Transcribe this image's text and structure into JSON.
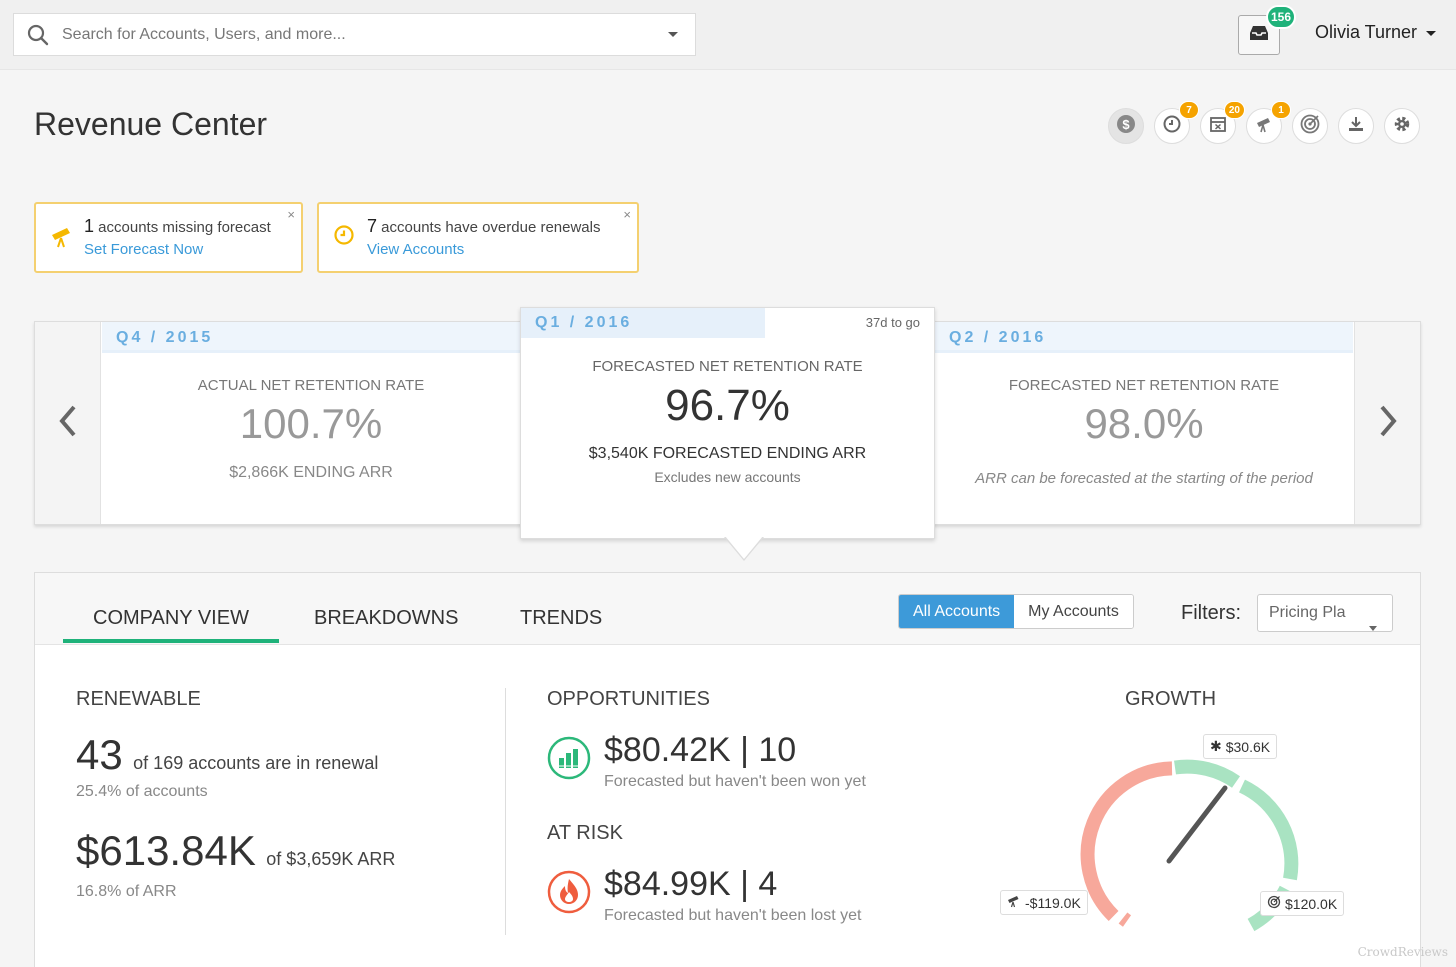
{
  "search": {
    "placeholder": "Search for Accounts, Users, and more..."
  },
  "header": {
    "inbox_count": "156",
    "user_name": "Olivia Turner"
  },
  "page": {
    "title": "Revenue Center"
  },
  "toolbar": {
    "icons": [
      {
        "name": "dollar-icon",
        "badge": ""
      },
      {
        "name": "clock-icon",
        "badge": "7"
      },
      {
        "name": "calendar-icon",
        "badge": "20"
      },
      {
        "name": "telescope-icon",
        "badge": "1"
      },
      {
        "name": "target-icon",
        "badge": ""
      },
      {
        "name": "download-icon",
        "badge": ""
      },
      {
        "name": "gear-icon",
        "badge": ""
      }
    ]
  },
  "alerts": [
    {
      "count": "1",
      "text": " accounts missing forecast",
      "link": "Set Forecast Now",
      "close": "×"
    },
    {
      "count": "7",
      "text": " accounts have overdue renewals",
      "link": "View Accounts",
      "close": "×"
    }
  ],
  "quarters": {
    "prev": {
      "label": "Q4 / 2015",
      "metric": "ACTUAL NET RETENTION RATE",
      "value": "100.7%",
      "sub": "$2,866K ENDING ARR"
    },
    "current": {
      "label": "Q1 / 2016",
      "to_go": "37d to go",
      "metric": "FORECASTED NET RETENTION RATE",
      "value": "96.7%",
      "sub": "$3,540K FORECASTED ENDING ARR",
      "note": "Excludes new accounts"
    },
    "next": {
      "label": "Q2 / 2016",
      "metric": "FORECASTED NET RETENTION RATE",
      "value": "98.0%",
      "note": "ARR can be forecasted at the starting of the period"
    }
  },
  "tabs": [
    "COMPANY VIEW",
    "BREAKDOWNS",
    "TRENDS"
  ],
  "account_toggle": {
    "all": "All Accounts",
    "mine": "My Accounts"
  },
  "filters": {
    "label": "Filters:",
    "selected": "Pricing Pla"
  },
  "renewable": {
    "title": "RENEWABLE",
    "count": "43",
    "count_text": "of 169 accounts are in renewal",
    "count_pct": "25.4% of accounts",
    "arr": "$613.84K",
    "arr_text": "of $3,659K ARR",
    "arr_pct": "16.8% of ARR"
  },
  "opportunities": {
    "title": "OPPORTUNITIES",
    "value": "$80.42K | 10",
    "desc": "Forecasted but haven't been won yet"
  },
  "at_risk": {
    "title": "AT RISK",
    "value": "$84.99K | 4",
    "desc": "Forecasted but haven't been lost yet"
  },
  "growth": {
    "title": "GROWTH",
    "top_label": "$30.6K",
    "left_label": "-$119.0K",
    "right_label": "$120.0K",
    "colors": {
      "negative": "#f7a89b",
      "positive": "#a9e3c2",
      "needle": "#555555"
    }
  },
  "watermark": "CrowdReviews"
}
